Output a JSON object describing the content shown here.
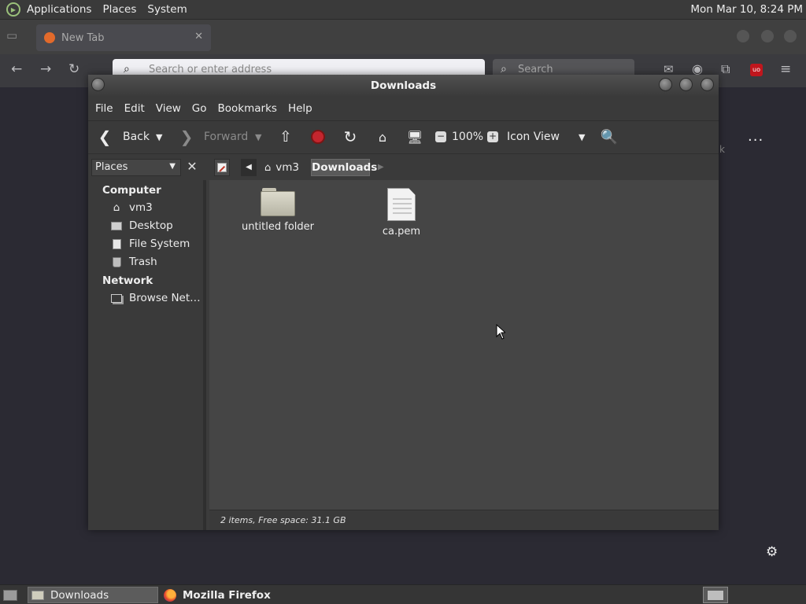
{
  "top_panel": {
    "menus": [
      "Applications",
      "Places",
      "System"
    ],
    "clock": "Mon Mar 10,  8:24 PM"
  },
  "firefox": {
    "tab_title": "New Tab",
    "url_placeholder": "Search or enter address",
    "search_placeholder": "Search",
    "taskbar_label": "Mozilla Firefox"
  },
  "file_manager": {
    "title": "Downloads",
    "menubar": [
      "File",
      "Edit",
      "View",
      "Go",
      "Bookmarks",
      "Help"
    ],
    "toolbar": {
      "back": "Back",
      "forward": "Forward",
      "zoom": "100%",
      "view_mode": "Icon View"
    },
    "sidebar": {
      "selector": "Places",
      "sections": [
        {
          "heading": "Computer",
          "items": [
            {
              "label": "vm3",
              "icon": "home-icon"
            },
            {
              "label": "Desktop",
              "icon": "desktop-icon"
            },
            {
              "label": "File System",
              "icon": "drive-icon"
            },
            {
              "label": "Trash",
              "icon": "trash-icon"
            }
          ]
        },
        {
          "heading": "Network",
          "items": [
            {
              "label": "Browse Net…",
              "icon": "network-icon"
            }
          ]
        }
      ]
    },
    "breadcrumb": [
      "vm3",
      "Downloads"
    ],
    "files": [
      {
        "name": "untitled folder",
        "type": "folder"
      },
      {
        "name": "ca.pem",
        "type": "document"
      }
    ],
    "status": "2 items, Free space: 31.1 GB",
    "taskbar_label": "Downloads"
  }
}
